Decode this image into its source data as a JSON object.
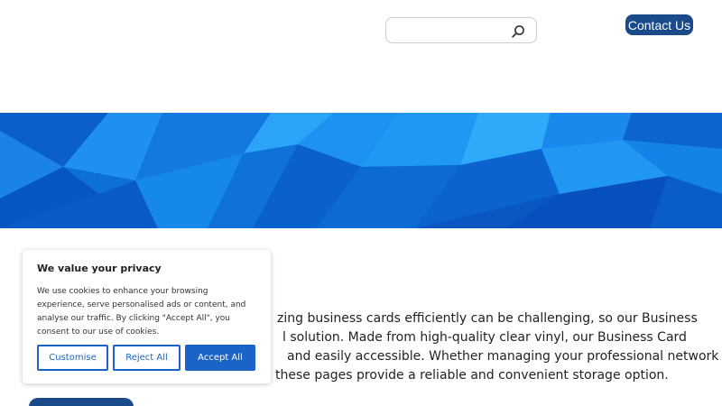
{
  "header": {
    "search": {
      "placeholder": "",
      "icon": "search-icon"
    },
    "contact_label": "Contact Us",
    "accent": "#1a4a8a"
  },
  "hero": {
    "colors": [
      "#0b6fd6",
      "#1a8fee",
      "#0a58c8",
      "#2aa6f7",
      "#0948b6"
    ]
  },
  "body_lines": [
    "zing business cards efficiently can be challenging, so our Business",
    "l solution. Made from high-quality clear vinyl, our Business Card",
    "and easily accessible. Whether managing your professional network",
    "these pages provide a reliable and convenient storage option."
  ],
  "cookie": {
    "title": "We value your privacy",
    "text": "We use cookies to enhance your browsing experience, serve personalised ads or content, and analyse our traffic. By clicking \"Accept All\", you consent to our use of cookies.",
    "customise": "Customise",
    "reject": "Reject All",
    "accept": "Accept All",
    "accent": "#1a63c7"
  }
}
